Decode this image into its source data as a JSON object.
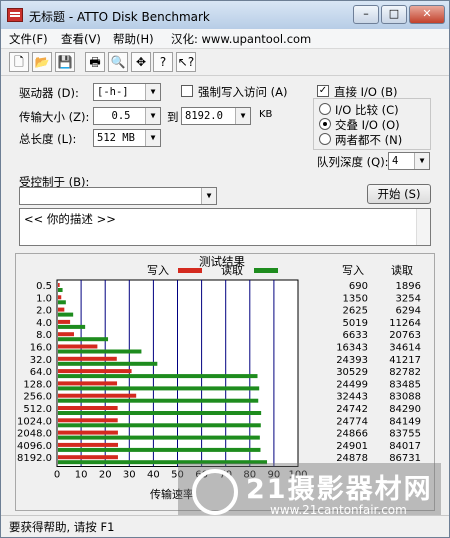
{
  "window": {
    "title": "无标题 - ATTO Disk Benchmark"
  },
  "menu": {
    "file": "文件(F)",
    "view": "查看(V)",
    "help": "帮助(H)",
    "localize": "汉化: www.upantool.com"
  },
  "controls": {
    "drive_label": "驱动器 (D):",
    "drive_value": "[-h-]",
    "transfer_label": "传输大小 (Z):",
    "transfer_from": "0.5",
    "to_label": "到",
    "transfer_to": "8192.0",
    "kb": "KB",
    "length_label": "总长度 (L):",
    "length_value": "512 MB",
    "force_write": "强制写入访问 (A)",
    "direct_io": "直接 I/O (B)",
    "io_compare": "I/O 比较 (C)",
    "overlap_io": "交叠 I/O (O)",
    "neither": "两者都不 (N)",
    "queue_label": "队列深度 (Q):",
    "queue_value": "4",
    "controlled_label": "受控制于 (B):",
    "start_button": "开始 (S)",
    "description": "<<  你的描述  >>"
  },
  "checkboxes": {
    "force_write": false,
    "direct_io": true
  },
  "radios": {
    "selected": "overlap_io"
  },
  "chart_data": {
    "type": "bar",
    "title": "测试结果",
    "xlabel": "传输速率",
    "legend_write": "写入",
    "legend_read": "读取",
    "col_write": "写入",
    "col_read": "读取",
    "colors": {
      "write": "#d42a1f",
      "read": "#1e8c1e",
      "grid": "#000080"
    },
    "xlim": [
      0,
      100
    ],
    "x_ticks": [
      "0",
      "10",
      "20",
      "30",
      "40",
      "50",
      "60",
      "70",
      "80",
      "90",
      "100"
    ],
    "categories": [
      "0.5",
      "1.0",
      "2.0",
      "4.0",
      "8.0",
      "16.0",
      "32.0",
      "64.0",
      "128.0",
      "256.0",
      "512.0",
      "1024.0",
      "2048.0",
      "4096.0",
      "8192.0"
    ],
    "write_values": [
      690,
      1350,
      2625,
      5019,
      6633,
      16343,
      24393,
      30529,
      24499,
      32443,
      24742,
      24774,
      24866,
      24901,
      24878
    ],
    "read_values": [
      1896,
      3254,
      6294,
      11264,
      20763,
      34614,
      41217,
      82782,
      83485,
      83088,
      84290,
      84149,
      83755,
      84017,
      86731
    ],
    "write_labels": [
      "690",
      "1350",
      "2625",
      "5019",
      "6633",
      "16343",
      "24393",
      "30529",
      "24499",
      "32443",
      "24742",
      "24774",
      "24866",
      "24901",
      "24878"
    ],
    "read_labels": [
      "1896",
      "3254",
      "6294",
      "11264",
      "20763",
      "34614",
      "41217",
      "82782",
      "83485",
      "83088",
      "84290",
      "84149",
      "83755",
      "84017",
      "86731"
    ]
  },
  "status": {
    "text": "要获得帮助, 请按 F1"
  },
  "watermark": {
    "text": "21摄影器材网",
    "url": "www.21cantonfair.com"
  }
}
